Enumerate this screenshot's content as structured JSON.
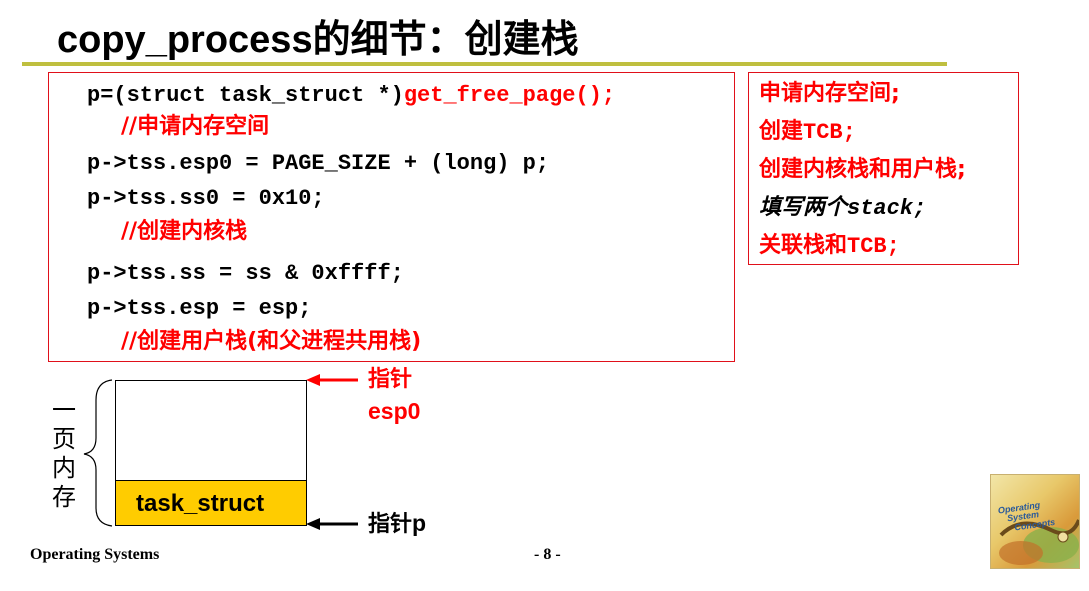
{
  "title": "copy_process的细节：创建栈",
  "code": {
    "line1_black": "p=(struct task_struct *)",
    "line1_red": "get_free_page();",
    "comment1": "//申请内存空间",
    "line2": "p->tss.esp0 = PAGE_SIZE + (long) p;",
    "line3": "p->tss.ss0 = 0x10;",
    "comment2": "//创建内核栈",
    "line4": "p->tss.ss = ss & 0xffff;",
    "line5": "p->tss.esp = esp;",
    "comment3": "//创建用户栈(和父进程共用栈)"
  },
  "summary": {
    "item1": "申请内存空间;",
    "item2_cn": "创建",
    "item2_mono": "TCB;",
    "item3": "创建内核栈和用户栈;",
    "item4_cn": "填写两个",
    "item4_mono": "stack;",
    "item5_cn": "关联栈和",
    "item5_mono": "TCB;"
  },
  "diagram": {
    "page_label_chars": [
      "一",
      "页",
      "内",
      "存"
    ],
    "task_struct_label": "task_struct",
    "pointer_top_label": "指针",
    "pointer_top_value": "esp0",
    "pointer_bottom_label": "指针",
    "pointer_bottom_value": "p",
    "colors": {
      "arrow_top": "#ff0000",
      "arrow_bottom": "#000000",
      "task_struct_fill": "#ffcc00"
    }
  },
  "footer": {
    "left": "Operating Systems",
    "center": "- 8 -"
  },
  "book": {
    "title_line1": "Operating",
    "title_line2": "System",
    "title_line3": "Concepts"
  },
  "colors": {
    "accent_red": "#ff0000",
    "rule_olive": "#bfbf3f"
  }
}
